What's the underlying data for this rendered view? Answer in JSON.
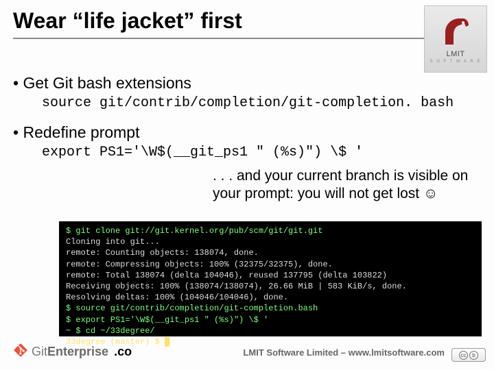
{
  "title": "Wear “life jacket” first",
  "logo": {
    "name": "LMIT",
    "sub": "S O F T W A R E"
  },
  "bullets": {
    "b1": "Get Git bash extensions",
    "code1": "source git/contrib/completion/git-completion. bash",
    "b2": "Redefine prompt",
    "code2": "export PS1='\\W$(__git_ps1 \" (%s)\") \\$ '"
  },
  "subtext": ". . . and your current branch is visible on your prompt: you will not get lost ☺",
  "terminal": {
    "l1": "$ git clone git://git.kernel.org/pub/scm/git/git.git",
    "l2": "Cloning into git...",
    "l3": "remote: Counting objects: 138074, done.",
    "l4": "remote: Compressing objects: 100% (32375/32375), done.",
    "l5": "remote: Total 138074 (delta 104046), reused 137795 (delta 103822)",
    "l6": "Receiving objects: 100% (138074/138074), 26.66 MiB | 583 KiB/s, done.",
    "l7": "Resolving deltas: 100% (104046/104046), done.",
    "l8": "$ source git/contrib/completion/git-completion.bash",
    "l9": "$ export PS1='\\W$(__git_ps1 \" (%s)\") \\$ '",
    "l10": "~ $ cd ~/33degree/",
    "l11": "33degree (master) $ █"
  },
  "footer": {
    "brand_prefix": "Git",
    "brand_suffix": "Enterprise",
    "brand_tail": ".co",
    "right": "LMIT Software Limited – www.lmitsoftware.com",
    "cc_a": "cc",
    "cc_b": "b"
  }
}
